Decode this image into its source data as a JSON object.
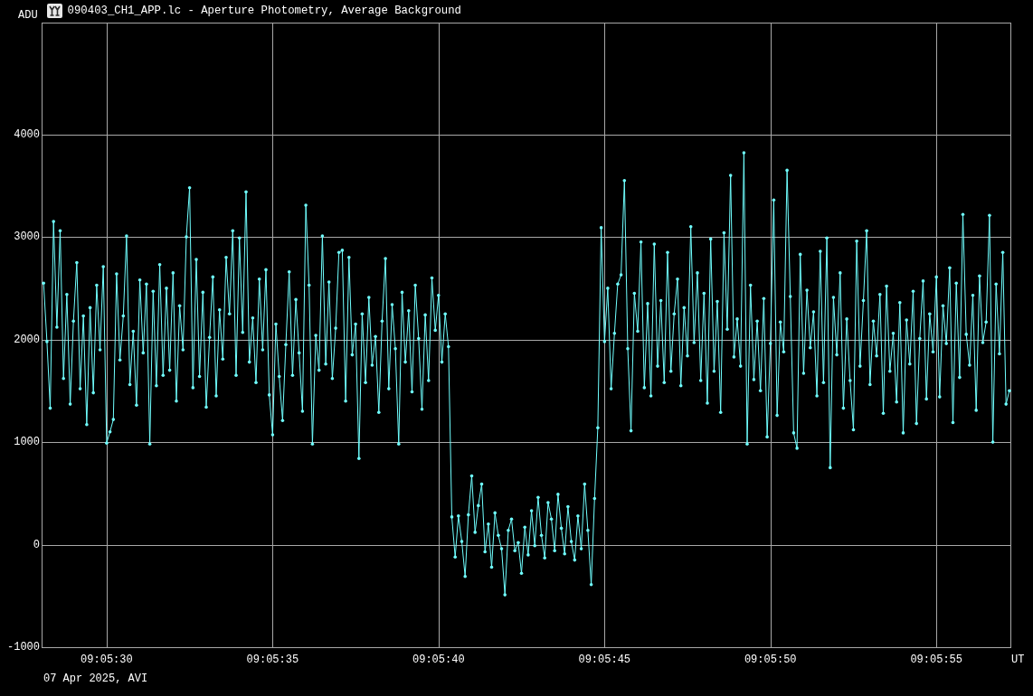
{
  "chart_data": {
    "type": "line",
    "title": "090403_CH1_APP.lc - Aperture Photometry, Average Background",
    "xlabel": "UT",
    "ylabel": "ADU",
    "grid": true,
    "x": [
      32728.1,
      32728.2,
      32728.3,
      32728.4,
      32728.5,
      32728.6,
      32728.7,
      32728.8,
      32728.9,
      32729.0,
      32729.1,
      32729.2,
      32729.3,
      32729.4,
      32729.5,
      32729.6,
      32729.7,
      32729.8,
      32729.9,
      32730.0,
      32730.1,
      32730.2,
      32730.3,
      32730.4,
      32730.5,
      32730.6,
      32730.7,
      32730.8,
      32730.9,
      32731.0,
      32731.1,
      32731.2,
      32731.3,
      32731.4,
      32731.5,
      32731.6,
      32731.7,
      32731.8,
      32731.9,
      32732.0,
      32732.1,
      32732.2,
      32732.3,
      32732.4,
      32732.5,
      32732.6,
      32732.7,
      32732.8,
      32732.9,
      32733.0,
      32733.1,
      32733.2,
      32733.3,
      32733.4,
      32733.5,
      32733.6,
      32733.7,
      32733.8,
      32733.9,
      32734.0,
      32734.1,
      32734.2,
      32734.3,
      32734.4,
      32734.5,
      32734.6,
      32734.7,
      32734.8,
      32734.9,
      32735.0,
      32735.1,
      32735.2,
      32735.3,
      32735.4,
      32735.5,
      32735.6,
      32735.7,
      32735.8,
      32735.9,
      32736.0,
      32736.1,
      32736.2,
      32736.3,
      32736.4,
      32736.5,
      32736.6,
      32736.7,
      32736.8,
      32736.9,
      32737.0,
      32737.1,
      32737.2,
      32737.3,
      32737.4,
      32737.5,
      32737.6,
      32737.7,
      32737.8,
      32737.9,
      32738.0,
      32738.1,
      32738.2,
      32738.3,
      32738.4,
      32738.5,
      32738.6,
      32738.7,
      32738.8,
      32738.9,
      32739.0,
      32739.1,
      32739.2,
      32739.3,
      32739.4,
      32739.5,
      32739.6,
      32739.7,
      32739.8,
      32739.9,
      32740.0,
      32740.1,
      32740.2,
      32740.3,
      32740.4,
      32740.5,
      32740.6,
      32740.7,
      32740.8,
      32740.9,
      32741.0,
      32741.1,
      32741.2,
      32741.3,
      32741.4,
      32741.5,
      32741.6,
      32741.7,
      32741.8,
      32741.9,
      32742.0,
      32742.1,
      32742.2,
      32742.3,
      32742.4,
      32742.5,
      32742.6,
      32742.7,
      32742.8,
      32742.9,
      32743.0,
      32743.1,
      32743.2,
      32743.3,
      32743.4,
      32743.5,
      32743.6,
      32743.7,
      32743.8,
      32743.9,
      32744.0,
      32744.1,
      32744.2,
      32744.3,
      32744.4,
      32744.5,
      32744.6,
      32744.7,
      32744.8,
      32744.9,
      32745.0,
      32745.1,
      32745.2,
      32745.3,
      32745.4,
      32745.5,
      32745.6,
      32745.7,
      32745.8,
      32745.9,
      32746.0,
      32746.1,
      32746.2,
      32746.3,
      32746.4,
      32746.5,
      32746.6,
      32746.7,
      32746.8,
      32746.9,
      32747.0,
      32747.1,
      32747.2,
      32747.3,
      32747.4,
      32747.5,
      32747.6,
      32747.7,
      32747.8,
      32747.9,
      32748.0,
      32748.1,
      32748.2,
      32748.3,
      32748.4,
      32748.5,
      32748.6,
      32748.7,
      32748.8,
      32748.9,
      32749.0,
      32749.1,
      32749.2,
      32749.3,
      32749.4,
      32749.5,
      32749.6,
      32749.7,
      32749.8,
      32749.9,
      32750.0,
      32750.1,
      32750.2,
      32750.3,
      32750.4,
      32750.5,
      32750.6,
      32750.7,
      32750.8,
      32750.9,
      32751.0,
      32751.1,
      32751.2,
      32751.3,
      32751.4,
      32751.5,
      32751.6,
      32751.7,
      32751.8,
      32751.9,
      32752.0,
      32752.1,
      32752.2,
      32752.3,
      32752.4,
      32752.5,
      32752.6,
      32752.7,
      32752.8,
      32752.9,
      32753.0,
      32753.1,
      32753.2,
      32753.3,
      32753.4,
      32753.5,
      32753.6,
      32753.7,
      32753.8,
      32753.9,
      32754.0,
      32754.1,
      32754.2,
      32754.3,
      32754.4,
      32754.5,
      32754.6,
      32754.7,
      32754.8,
      32754.9,
      32755.0,
      32755.1,
      32755.2,
      32755.3,
      32755.4,
      32755.5,
      32755.6,
      32755.7,
      32755.8,
      32755.9,
      32756.0,
      32756.1,
      32756.2,
      32756.3,
      32756.4,
      32756.5,
      32756.6,
      32756.7,
      32756.8,
      32756.9,
      32757.0,
      32757.1,
      32757.2
    ],
    "series": [
      {
        "color": "#70ffff",
        "values": [
          2550,
          1980,
          1330,
          3150,
          2120,
          3060,
          1620,
          2440,
          1370,
          2180,
          2750,
          1520,
          2230,
          1170,
          2310,
          1480,
          2530,
          1900,
          2710,
          990,
          1100,
          1220,
          2640,
          1800,
          2230,
          3010,
          1560,
          2080,
          1360,
          2580,
          1870,
          2540,
          980,
          2470,
          1550,
          2730,
          1650,
          2500,
          1700,
          2650,
          1400,
          2330,
          1900,
          3000,
          3480,
          1530,
          2780,
          1640,
          2460,
          1340,
          2020,
          2610,
          1450,
          2290,
          1810,
          2800,
          2250,
          3060,
          1650,
          2990,
          2070,
          3440,
          1780,
          2210,
          1580,
          2590,
          1900,
          2680,
          1460,
          1070,
          2150,
          1640,
          1210,
          1950,
          2660,
          1650,
          2390,
          1870,
          1300,
          3310,
          2530,
          980,
          2040,
          1700,
          3010,
          1760,
          2560,
          1620,
          2110,
          2850,
          2870,
          1400,
          2800,
          1850,
          2150,
          840,
          2250,
          1580,
          2410,
          1750,
          2030,
          1290,
          2180,
          2790,
          1520,
          2340,
          1910,
          980,
          2460,
          1780,
          2280,
          1490,
          2530,
          2010,
          1320,
          2240,
          1600,
          2600,
          2090,
          2430,
          1780,
          2250,
          1930,
          270,
          -120,
          280,
          30,
          -310,
          290,
          670,
          120,
          380,
          590,
          -70,
          200,
          -220,
          310,
          90,
          -40,
          -490,
          140,
          250,
          -60,
          20,
          -280,
          170,
          -100,
          330,
          -10,
          460,
          90,
          -130,
          410,
          250,
          -60,
          490,
          160,
          -90,
          370,
          30,
          -150,
          280,
          -40,
          590,
          140,
          -390,
          450,
          1140,
          3090,
          1980,
          2500,
          1520,
          2060,
          2540,
          2630,
          3550,
          1910,
          1110,
          2450,
          2080,
          2950,
          1530,
          2350,
          1450,
          2930,
          1740,
          2380,
          1580,
          2850,
          1690,
          2250,
          2590,
          1550,
          2310,
          1840,
          3100,
          1970,
          2650,
          1600,
          2450,
          1380,
          2980,
          1690,
          2370,
          1290,
          3040,
          2100,
          3600,
          1830,
          2200,
          1740,
          3820,
          980,
          2530,
          1610,
          2180,
          1500,
          2400,
          1050,
          1960,
          3360,
          1260,
          2170,
          1880,
          3650,
          2420,
          1090,
          940,
          2830,
          1670,
          2480,
          1920,
          2270,
          1450,
          2860,
          1580,
          2990,
          750,
          2410,
          1850,
          2650,
          1330,
          2200,
          1600,
          1120,
          2960,
          1740,
          2380,
          3060,
          1560,
          2180,
          1840,
          2440,
          1280,
          2520,
          1690,
          2060,
          1390,
          2360,
          1090,
          2190,
          1760,
          2470,
          1180,
          2010,
          2570,
          1420,
          2250,
          1880,
          2610,
          1440,
          2330,
          1960,
          2700,
          1190,
          2550,
          1630,
          3220,
          2050,
          1750,
          2430,
          1310,
          2620,
          1970,
          2170,
          3210,
          1000,
          2540,
          1860,
          2850,
          1370,
          1500
        ]
      }
    ],
    "xlim": [
      32728.04,
      32757.23
    ],
    "ylim": [
      -1000,
      5090
    ],
    "xticks": [
      {
        "value": 32730,
        "label": "09:05:30"
      },
      {
        "value": 32735,
        "label": "09:05:35"
      },
      {
        "value": 32740,
        "label": "09:05:40"
      },
      {
        "value": 32745,
        "label": "09:05:45"
      },
      {
        "value": 32750,
        "label": "09:05:50"
      },
      {
        "value": 32755,
        "label": "09:05:55"
      }
    ],
    "yticks": [
      -1000,
      0,
      1000,
      2000,
      3000,
      4000
    ]
  },
  "footer": {
    "caption": "07 Apr 2025, AVI"
  }
}
